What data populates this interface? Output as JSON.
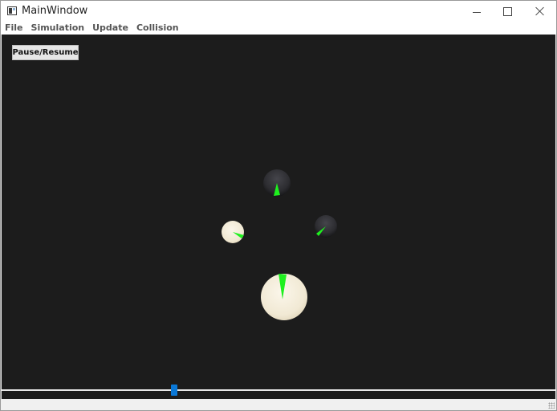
{
  "window": {
    "title": "MainWindow"
  },
  "menu": {
    "items": [
      "File",
      "Simulation",
      "Update",
      "Collision"
    ]
  },
  "toolbar": {
    "pause_resume_label": "Pause/Resume"
  },
  "scene": {
    "background_color": "#1c1c1c",
    "indicator_color": "#1ef01e",
    "balls": [
      {
        "name": "ball-dark-top",
        "color": "#2e2e32",
        "indicator": "needle"
      },
      {
        "name": "ball-light-left",
        "color": "#f3ecd9",
        "indicator": "needle"
      },
      {
        "name": "ball-dark-right",
        "color": "#2e2e32",
        "indicator": "needle"
      },
      {
        "name": "ball-light-bottom",
        "color": "#f3ecd9",
        "indicator": "needle"
      }
    ]
  },
  "timeline": {
    "slider_position": 0.31,
    "handle_color": "#0a78d7"
  }
}
